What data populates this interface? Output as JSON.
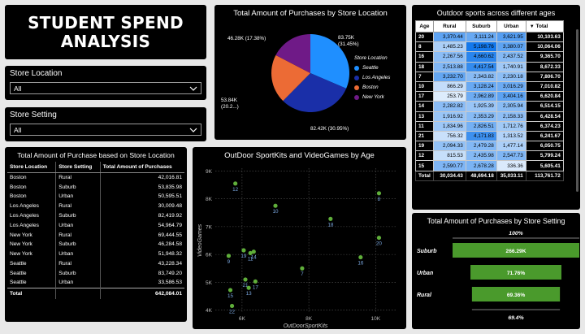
{
  "header": {
    "title_line1": "STUDENT SPEND",
    "title_line2": "ANALYSIS"
  },
  "slicers": [
    {
      "label": "Store Location",
      "value": "All"
    },
    {
      "label": "Store Setting",
      "value": "All"
    }
  ],
  "pie": {
    "title": "Total Amount of Purchases by Store Location",
    "legend_title": "Store Location",
    "labels": [
      {
        "text": "83.75K",
        "sub": "(31.45%)"
      },
      {
        "text": "82.42K (30.95%)",
        "sub": ""
      },
      {
        "text": "53.84K",
        "sub": "(20.2...)"
      },
      {
        "text": "46.28K (17.38%)",
        "sub": ""
      }
    ]
  },
  "store_table": {
    "title": "Total Amount of Purchase based on Store Location",
    "headers": [
      "Store Location",
      "Store Setting",
      "Total Amount of Purchases"
    ],
    "rows": [
      [
        "Boston",
        "Rural",
        "42,016.81"
      ],
      [
        "Boston",
        "Suburb",
        "53,835.98"
      ],
      [
        "Boston",
        "Urban",
        "50,595.51"
      ],
      [
        "Los Angeles",
        "Rural",
        "30,009.48"
      ],
      [
        "Los Angeles",
        "Suburb",
        "82,419.92"
      ],
      [
        "Los Angeles",
        "Urban",
        "54,964.79"
      ],
      [
        "New York",
        "Rural",
        "69,444.55"
      ],
      [
        "New York",
        "Suburb",
        "46,284.58"
      ],
      [
        "New York",
        "Urban",
        "51,948.32"
      ],
      [
        "Seattle",
        "Rural",
        "43,228.34"
      ],
      [
        "Seattle",
        "Suburb",
        "83,749.20"
      ],
      [
        "Seattle",
        "Urban",
        "33,586.53"
      ]
    ],
    "total_label": "Total",
    "total_value": "642,084.01"
  },
  "age_table": {
    "title": "Outdoor sports across different ages",
    "headers": [
      "Age",
      "Rural",
      "Suburb",
      "Urban",
      "Total"
    ],
    "rows": [
      [
        "20",
        "3,370.44",
        "3,111.24",
        "3,621.95",
        "10,103.63"
      ],
      [
        "8",
        "1,485.23",
        "5,198.76",
        "3,380.07",
        "10,064.06"
      ],
      [
        "16",
        "2,267.56",
        "4,660.62",
        "2,437.52",
        "9,365.70"
      ],
      [
        "18",
        "2,513.88",
        "4,417.54",
        "1,740.91",
        "8,672.33"
      ],
      [
        "7",
        "3,232.70",
        "2,343.82",
        "2,230.18",
        "7,806.70"
      ],
      [
        "10",
        "866.29",
        "3,128.24",
        "3,016.29",
        "7,010.82"
      ],
      [
        "17",
        "253.79",
        "2,962.89",
        "3,404.16",
        "6,620.84"
      ],
      [
        "14",
        "2,282.82",
        "1,925.39",
        "2,305.94",
        "6,514.15"
      ],
      [
        "13",
        "1,916.92",
        "2,353.29",
        "2,158.33",
        "6,428.54"
      ],
      [
        "11",
        "1,834.96",
        "2,826.51",
        "1,712.76",
        "6,374.23"
      ],
      [
        "21",
        "756.32",
        "4,171.83",
        "1,313.52",
        "6,241.67"
      ],
      [
        "19",
        "2,094.33",
        "2,479.28",
        "1,477.14",
        "6,050.75"
      ],
      [
        "12",
        "815.53",
        "2,435.98",
        "2,547.73",
        "5,799.24"
      ],
      [
        "15",
        "2,590.77",
        "2,678.28",
        "336.36",
        "5,605.41"
      ]
    ],
    "total_label": "Total",
    "totals": [
      "30,034.43",
      "48,694.18",
      "35,033.11",
      "113,761.72"
    ]
  },
  "funnel": {
    "title": "Total Amount of Purchases by Store Setting",
    "top_label": "100%",
    "bottom_label": "69.4%",
    "bar_color": "#4a9a2c"
  },
  "chart_data": [
    {
      "type": "pie",
      "title": "Total Amount of Purchases by Store Location",
      "legend_title": "Store Location",
      "legend_position": "right",
      "slices": [
        {
          "name": "Seattle",
          "value": 83.75,
          "percent": 31.45,
          "color": "#1f8fff"
        },
        {
          "name": "Los Angeles",
          "value": 82.42,
          "percent": 30.95,
          "color": "#1a2fa8"
        },
        {
          "name": "Boston",
          "value": 53.84,
          "percent": 20.22,
          "color": "#ec6b35"
        },
        {
          "name": "New York",
          "value": 46.28,
          "percent": 17.38,
          "color": "#6f1a87"
        }
      ],
      "unit": "K"
    },
    {
      "type": "scatter",
      "title": "OutDoor SportKits and VideoGames by Age",
      "xlabel": "OutDoorSportKits",
      "ylabel": "VideoGames",
      "xlim": [
        5200,
        10600
      ],
      "ylim": [
        3900,
        9100
      ],
      "xticks": [
        {
          "v": 6000,
          "t": "6K"
        },
        {
          "v": 8000,
          "t": "8K"
        },
        {
          "v": 10000,
          "t": "10K"
        }
      ],
      "yticks": [
        {
          "v": 4000,
          "t": "4K"
        },
        {
          "v": 5000,
          "t": "5K"
        },
        {
          "v": 6000,
          "t": "6K"
        },
        {
          "v": 7000,
          "t": "7K"
        },
        {
          "v": 8000,
          "t": "8K"
        },
        {
          "v": 9000,
          "t": "9K"
        }
      ],
      "grid": true,
      "point_color": "#5fae3a",
      "label_color": "#7aa7e0",
      "points": [
        {
          "label": "12",
          "x": 5800,
          "y": 8550
        },
        {
          "label": "10",
          "x": 7000,
          "y": 7750
        },
        {
          "label": "18",
          "x": 8650,
          "y": 7280
        },
        {
          "label": "8",
          "x": 10100,
          "y": 8200
        },
        {
          "label": "20",
          "x": 10100,
          "y": 6600
        },
        {
          "label": "14",
          "x": 6350,
          "y": 6100
        },
        {
          "label": "19",
          "x": 6050,
          "y": 6150
        },
        {
          "label": "11",
          "x": 6250,
          "y": 6050
        },
        {
          "label": "9",
          "x": 5600,
          "y": 5950
        },
        {
          "label": "16",
          "x": 9550,
          "y": 5900
        },
        {
          "label": "7",
          "x": 7800,
          "y": 5500
        },
        {
          "label": "21",
          "x": 6100,
          "y": 5100
        },
        {
          "label": "17",
          "x": 6400,
          "y": 5030
        },
        {
          "label": "13",
          "x": 6200,
          "y": 4800
        },
        {
          "label": "15",
          "x": 5650,
          "y": 4720
        },
        {
          "label": "22",
          "x": 5700,
          "y": 4150
        }
      ]
    },
    {
      "type": "bar",
      "subtype": "funnel",
      "title": "Total Amount of Purchases by Store Setting",
      "categories": [
        "Suburb",
        "Urban",
        "Rural"
      ],
      "values": [
        266.29,
        191.1,
        184.8
      ],
      "value_labels": [
        "266.29K",
        "71.76%",
        "69.36%"
      ],
      "percent_of_first": [
        100,
        71.76,
        69.36
      ],
      "unit": "K"
    }
  ]
}
